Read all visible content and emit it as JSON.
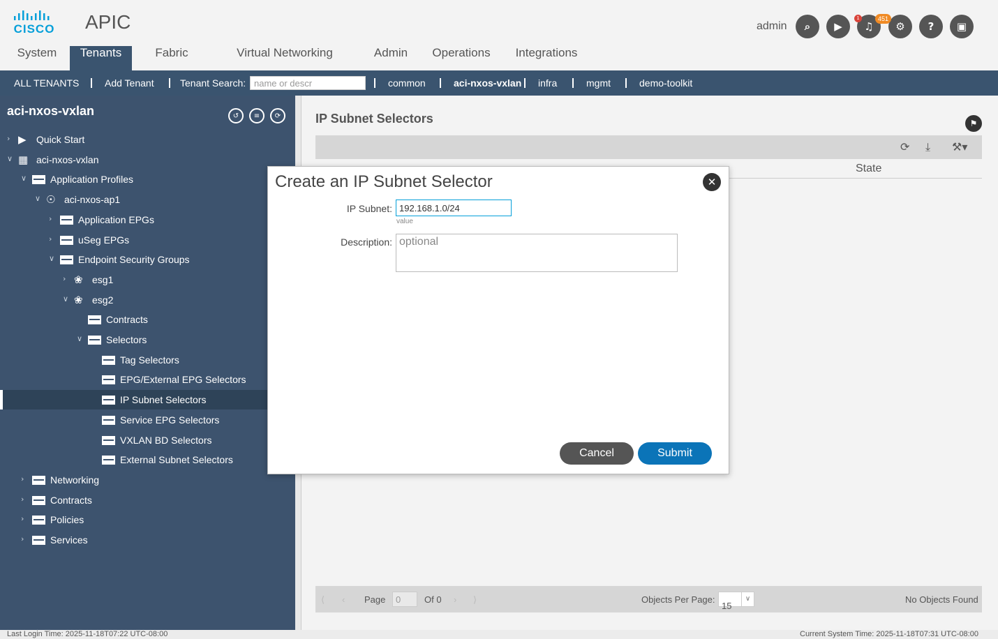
{
  "header": {
    "logo_text": "CISCO",
    "app_title": "APIC",
    "user": "admin",
    "icons": [
      {
        "name": "search-icon",
        "glyph": "⌕"
      },
      {
        "name": "announcement-icon",
        "glyph": "▶"
      },
      {
        "name": "alerts-icon",
        "glyph": "♫"
      },
      {
        "name": "settings-icon",
        "glyph": "⚙"
      },
      {
        "name": "help-icon",
        "glyph": "?"
      },
      {
        "name": "screen-icon",
        "glyph": "▣"
      }
    ],
    "alert_badge": "451",
    "alert_dot": "1"
  },
  "tabs": [
    "System",
    "Tenants",
    "Fabric",
    "Virtual Networking",
    "Admin",
    "Operations",
    "Integrations"
  ],
  "subnav": {
    "all_tenants": "ALL TENANTS",
    "add_tenant": "Add Tenant",
    "search_label": "Tenant Search:",
    "search_placeholder": "name or descr",
    "tenants": [
      "common",
      "aci-nxos-vxlan",
      "infra",
      "mgmt",
      "demo-toolkit"
    ]
  },
  "sidebar": {
    "title": "aci-nxos-vxlan",
    "tree": [
      {
        "label": "Quick Start",
        "level": 0,
        "chev": "›",
        "icon": "quickstart"
      },
      {
        "label": "aci-nxos-vxlan",
        "level": 0,
        "chev": "∨",
        "icon": "tenant"
      },
      {
        "label": "Application Profiles",
        "level": 1,
        "chev": "∨",
        "icon": "folder"
      },
      {
        "label": "aci-nxos-ap1",
        "level": 2,
        "chev": "∨",
        "icon": "app"
      },
      {
        "label": "Application EPGs",
        "level": 3,
        "chev": "›",
        "icon": "folder"
      },
      {
        "label": "uSeg EPGs",
        "level": 3,
        "chev": "›",
        "icon": "folder"
      },
      {
        "label": "Endpoint Security Groups",
        "level": 3,
        "chev": "∨",
        "icon": "folder"
      },
      {
        "label": "esg1",
        "level": 4,
        "chev": "›",
        "icon": "esg"
      },
      {
        "label": "esg2",
        "level": 4,
        "chev": "∨",
        "icon": "esg"
      },
      {
        "label": "Contracts",
        "level": 5,
        "chev": "",
        "icon": "folder"
      },
      {
        "label": "Selectors",
        "level": 5,
        "chev": "∨",
        "icon": "folder"
      },
      {
        "label": "Tag Selectors",
        "level": 6,
        "chev": "",
        "icon": "folder"
      },
      {
        "label": "EPG/External EPG Selectors",
        "level": 6,
        "chev": "",
        "icon": "folder"
      },
      {
        "label": "IP Subnet Selectors",
        "level": 6,
        "chev": "",
        "icon": "folder",
        "selected": true
      },
      {
        "label": "Service EPG Selectors",
        "level": 6,
        "chev": "",
        "icon": "folder"
      },
      {
        "label": "VXLAN BD Selectors",
        "level": 6,
        "chev": "",
        "icon": "folder"
      },
      {
        "label": "External Subnet Selectors",
        "level": 6,
        "chev": "",
        "icon": "folder"
      },
      {
        "label": "Networking",
        "level": 1,
        "chev": "›",
        "icon": "folder"
      },
      {
        "label": "Contracts",
        "level": 1,
        "chev": "›",
        "icon": "folder"
      },
      {
        "label": "Policies",
        "level": 1,
        "chev": "›",
        "icon": "folder"
      },
      {
        "label": "Services",
        "level": 1,
        "chev": "›",
        "icon": "folder"
      }
    ]
  },
  "main": {
    "title": "IP Subnet Selectors",
    "columns": [
      "State"
    ],
    "pager": {
      "page_label": "Page",
      "page_value": "0",
      "of_label": "Of 0",
      "per_page_label": "Objects Per Page:",
      "per_page_value": "15",
      "empty_text": "No Objects Found"
    }
  },
  "modal": {
    "title": "Create an IP Subnet Selector",
    "ip_label": "IP Subnet:",
    "ip_value": "192.168.1.0/24",
    "ip_hint": "value",
    "desc_label": "Description:",
    "desc_placeholder": "optional",
    "cancel": "Cancel",
    "submit": "Submit"
  },
  "status": {
    "last_login": "Last Login Time: 2025-11-18T07:22 UTC-08:00",
    "current_time": "Current System Time: 2025-11-18T07:31 UTC-08:00"
  },
  "colors": {
    "nav_bg": "#3a546f",
    "sidebar_bg": "#3d536e",
    "accent": "#049fd9",
    "submit": "#0b74b8",
    "badge": "#f08a24"
  }
}
